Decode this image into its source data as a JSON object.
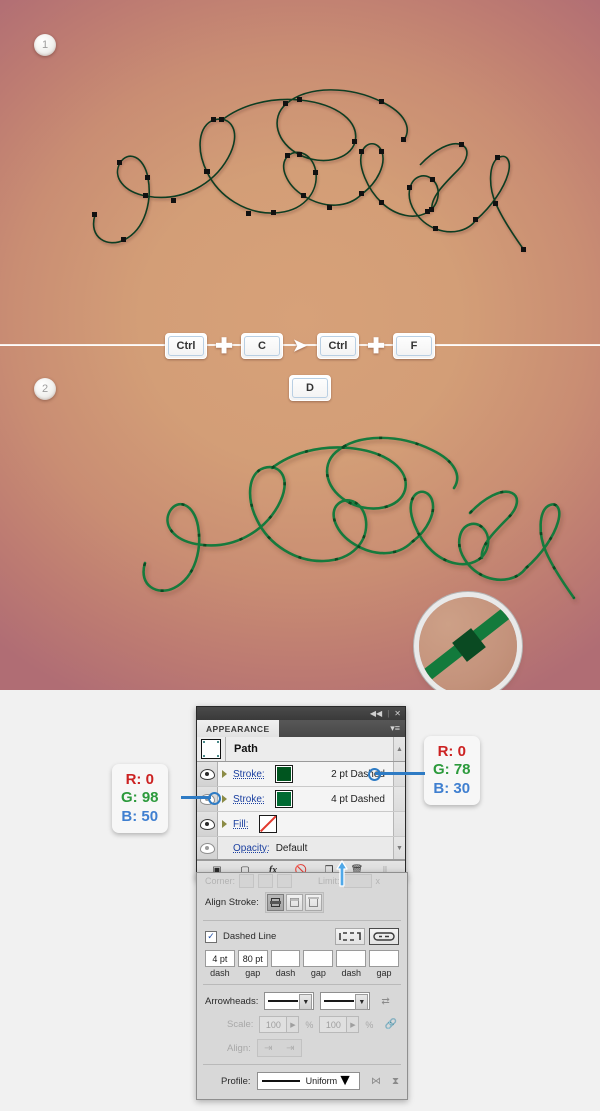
{
  "tutorial": {
    "step1": {
      "badge": "1"
    },
    "step2": {
      "badge": "2"
    },
    "artwork_word": "Santa"
  },
  "shortcut": {
    "keys": [
      {
        "label": "Ctrl",
        "name": "key-ctrl-1"
      },
      {
        "label": "C",
        "name": "key-c"
      },
      {
        "label": "Ctrl",
        "name": "key-ctrl-2"
      },
      {
        "label": "F",
        "name": "key-f"
      }
    ],
    "plus": "✚",
    "arrow": "➤",
    "extra_key": "D"
  },
  "callout_left": {
    "r": "R: 0",
    "g": "G: 98",
    "b": "B: 50"
  },
  "callout_right": {
    "r": "R: 0",
    "g": "G: 78",
    "b": "B: 30"
  },
  "appearance_panel": {
    "tab_label": "APPEARANCE",
    "collapse_icon": "◀◀",
    "close_icon": "✕",
    "menu_icon": "▾≡",
    "object_label": "Path",
    "rows": [
      {
        "label": "Stroke:",
        "value": "2 pt Dashed",
        "swatch": "#00551f",
        "kind": "stroke"
      },
      {
        "label": "Stroke:",
        "value": "4 pt Dashed",
        "swatch": "#006a32",
        "kind": "stroke"
      },
      {
        "label": "Fill:",
        "value": "",
        "swatch": "none",
        "kind": "fill"
      }
    ],
    "opacity_label": "Opacity:",
    "opacity_value": "Default",
    "footer_icons": [
      "new-art-has-basic-appearance",
      "add-new-stroke",
      "add-new-effect",
      "clear-appearance",
      "duplicate-selected-item",
      "delete-selected-item"
    ]
  },
  "stroke_panel": {
    "ghost_corner_label": "Corner:",
    "ghost_limit_label": "Limit:",
    "align_stroke_label": "Align Stroke:",
    "dashed_line_label": "Dashed Line",
    "dash_fields": [
      "4 pt",
      "80 pt",
      "",
      "",
      "",
      ""
    ],
    "dash_captions": [
      "dash",
      "gap",
      "dash",
      "gap",
      "dash",
      "gap"
    ],
    "arrowheads_label": "Arrowheads:",
    "scale_label": "Scale:",
    "scale_values": [
      "100",
      "100"
    ],
    "percent": "%",
    "align_label": "Align:",
    "profile_label": "Profile:",
    "profile_value": "Uniform"
  },
  "colors": {
    "stroke_dark": "#004e1e",
    "stroke_light": "#006232",
    "accent_blue": "#2e7bc4",
    "bg_center": "#d7a179",
    "bg_edge": "#b06d74"
  }
}
